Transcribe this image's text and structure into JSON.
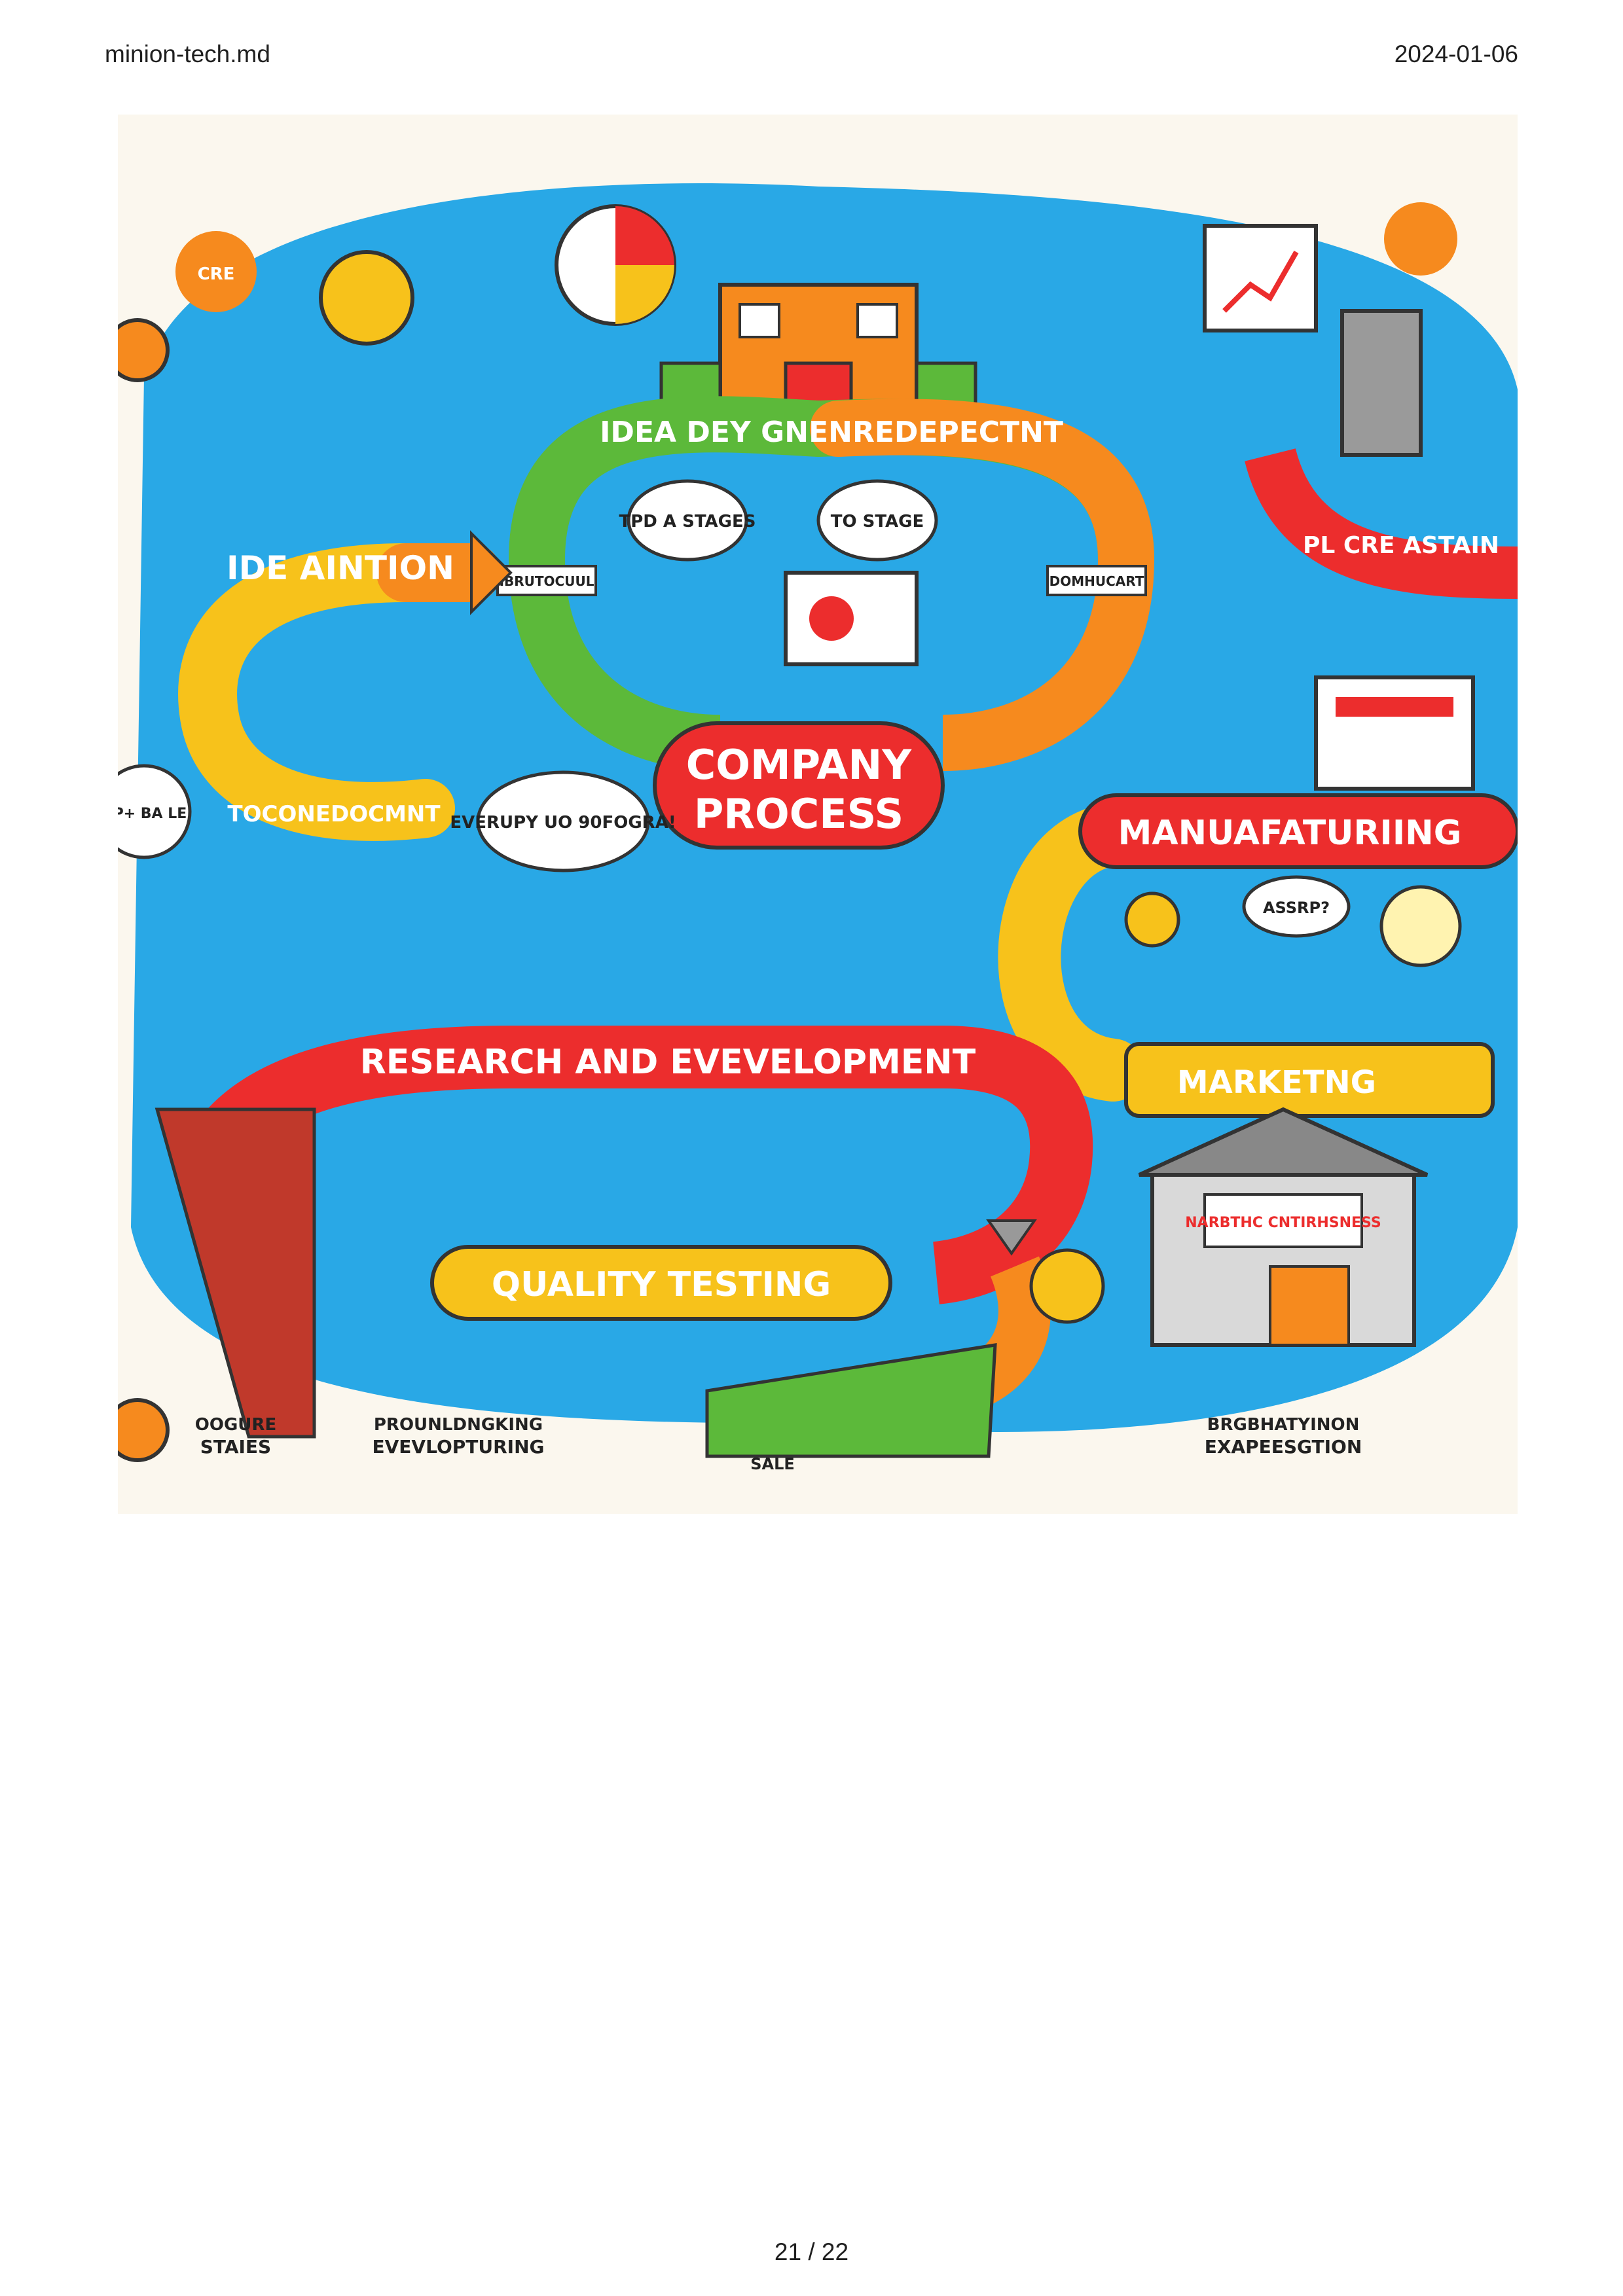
{
  "header": {
    "filename": "minion-tech.md",
    "date": "2024-01-06"
  },
  "footer": {
    "page_number": "21 / 22"
  },
  "illustration": {
    "center_label_line1": "COMPANY",
    "center_label_line2": "PROCESS",
    "arc_top": "IDEA DEY GNENREDEPECTNT",
    "arc_left": "IDE AINTION",
    "arc_left_bottom": "TOCONEDOCMNT",
    "bubble_top_left": "TPD A STAGES",
    "bubble_top_right": "TO STAGE",
    "bubble_mid": "EVERUPY UO 90FOGRA!",
    "bubble_marketing": "ASSRP?",
    "banner_right_top": "PL CRE ASTAIN",
    "manufacturing": "MANUAFATURIING",
    "research": "RESEARCH AND EVEVELOPMENT",
    "quality": "QUALITY TESTING",
    "marketing": "MARKETNG",
    "shop_sign": "NARBTHC CNTIRHSNESS",
    "sign_ideation": "IBRUTOCUUL",
    "sign_dom": "DOMHUCART",
    "bottom_left_line1": "OOGURE",
    "bottom_left_line2": "STAIES",
    "bottom_mid_line1": "PROUNLDNGKING",
    "bottom_mid_line2": "EVEVLOPTURING",
    "bottom_sale": "SALE",
    "bottom_right_line1": "BRGBHATYINON",
    "bottom_right_line2": "EXAPEESGTION",
    "left_edge": "UP+ BA LE"
  },
  "colors": {
    "sky": "#29a8e6",
    "bg": "#fbf7ee",
    "red": "#ec2d2d",
    "orange": "#f68a1e",
    "yellow": "#f7c21b",
    "green": "#5cb93a"
  }
}
